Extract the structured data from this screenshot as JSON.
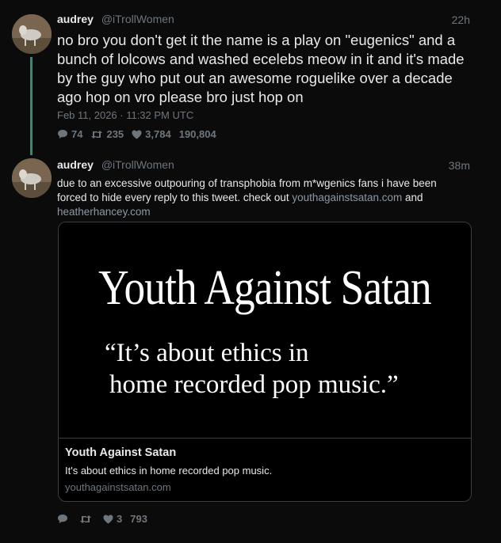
{
  "tweet1": {
    "name": "audrey",
    "handle": "@iTrollWomen",
    "time": "22h",
    "text": "no bro you don't get it the name is a play on \"eugenics\" and a bunch of lolcows and washed ecelebs meow in it and it's made by the guy who put out an awesome roguelike over a decade ago hop on vro please bro just hop on",
    "date": "Feb 11, 2026 · 11:32 PM UTC",
    "replies": "74",
    "retweets": "235",
    "likes": "3,784",
    "views": "190,804"
  },
  "tweet2": {
    "name": "audrey",
    "handle": "@iTrollWomen",
    "time": "38m",
    "text_before": "due to an excessive outpouring of transphobia from m*wgenics fans i have been forced to hide every reply to this tweet. check out ",
    "link1": "youthagainstsatan.com",
    "text_mid": " and ",
    "link2": "heatherhancey.com",
    "replies": "",
    "retweets": "",
    "likes": "3",
    "views": "793",
    "card": {
      "image_title": "Youth Against Satan",
      "image_quote_line1": "“It’s about ethics in",
      "image_quote_line2": "home recorded pop music.”",
      "title": "Youth Against Satan",
      "description": "It's about ethics in home recorded pop music.",
      "url": "youthagainstsatan.com"
    }
  },
  "icons": {
    "reply": "comment-icon",
    "retweet": "retweet-icon",
    "like": "heart-icon"
  }
}
